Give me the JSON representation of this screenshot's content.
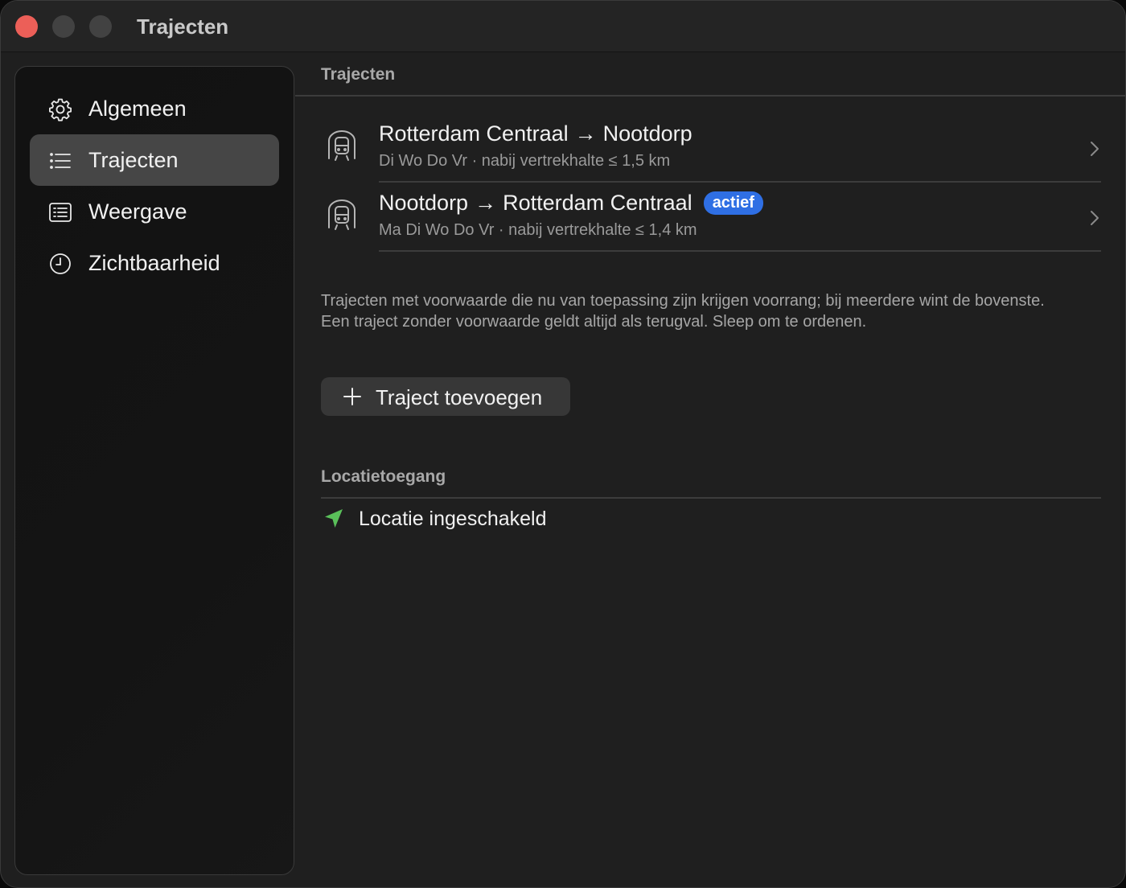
{
  "window": {
    "title": "Trajecten"
  },
  "sidebar": {
    "items": [
      {
        "label": "Algemeen",
        "icon": "gear-icon"
      },
      {
        "label": "Trajecten",
        "icon": "list-icon"
      },
      {
        "label": "Weergave",
        "icon": "display-icon"
      },
      {
        "label": "Zichtbaarheid",
        "icon": "clock-icon"
      }
    ],
    "selected": "Trajecten"
  },
  "main": {
    "section_title": "Trajecten",
    "routes": [
      {
        "from": "Rotterdam Centraal",
        "arrow": "→",
        "to": "Nootdorp",
        "subtitle": "Di Wo Do Vr · nabij vertrekhalte ≤ 1,5 km",
        "icon": "train-icon"
      },
      {
        "from": "Nootdorp",
        "arrow": "→",
        "to": "Rotterdam Centraal",
        "subtitle": "Ma Di Wo Do Vr · nabij vertrekhalte ≤ 1,4 km",
        "badge": "actief",
        "icon": "train-icon"
      }
    ],
    "footnote": "Trajecten met voorwaarde die nu van toepassing zijn krijgen voorrang; bij meerdere wint de bovenste. Een traject zonder voorwaarde geldt altijd als terugval. Sleep om te ordenen.",
    "add_button_label": "Traject toevoegen",
    "location_section_title": "Locatietoegang",
    "location_status": "Locatie ingeschakeld"
  },
  "colors": {
    "accent_badge": "#2f6fe4",
    "location_icon": "#5ac05a",
    "close_button": "#ec5f58"
  }
}
